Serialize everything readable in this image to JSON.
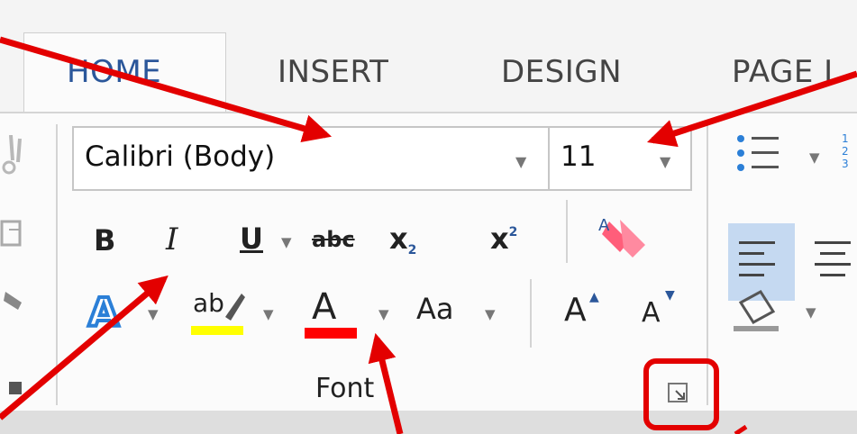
{
  "tabs": {
    "home": "HOME",
    "insert": "INSERT",
    "design": "DESIGN",
    "page_layout": "PAGE L"
  },
  "font_group": {
    "font_name": "Calibri (Body)",
    "font_size": "11",
    "label": "Font",
    "bold": "B",
    "italic": "I",
    "underline": "U",
    "strikethrough": "abc",
    "subscript": "x",
    "subscript_mark": "2",
    "superscript": "x",
    "superscript_mark": "2",
    "text_highlight": "ab",
    "font_color": "A",
    "change_case": "Aa",
    "grow_font": "A",
    "shrink_font": "A"
  },
  "colors": {
    "accent": "#2b579a",
    "highlight_swatch": "#ffff00",
    "font_color_swatch": "#ff0000",
    "annotation": "#e30000",
    "align_selected": "#c5d9f1"
  },
  "icons": [
    "clipboard-icon",
    "text-effects-icon",
    "clear-formatting-icon",
    "bullets-icon",
    "numbering-icon",
    "align-left-icon",
    "center-icon",
    "shading-icon",
    "dialog-launcher-icon"
  ]
}
